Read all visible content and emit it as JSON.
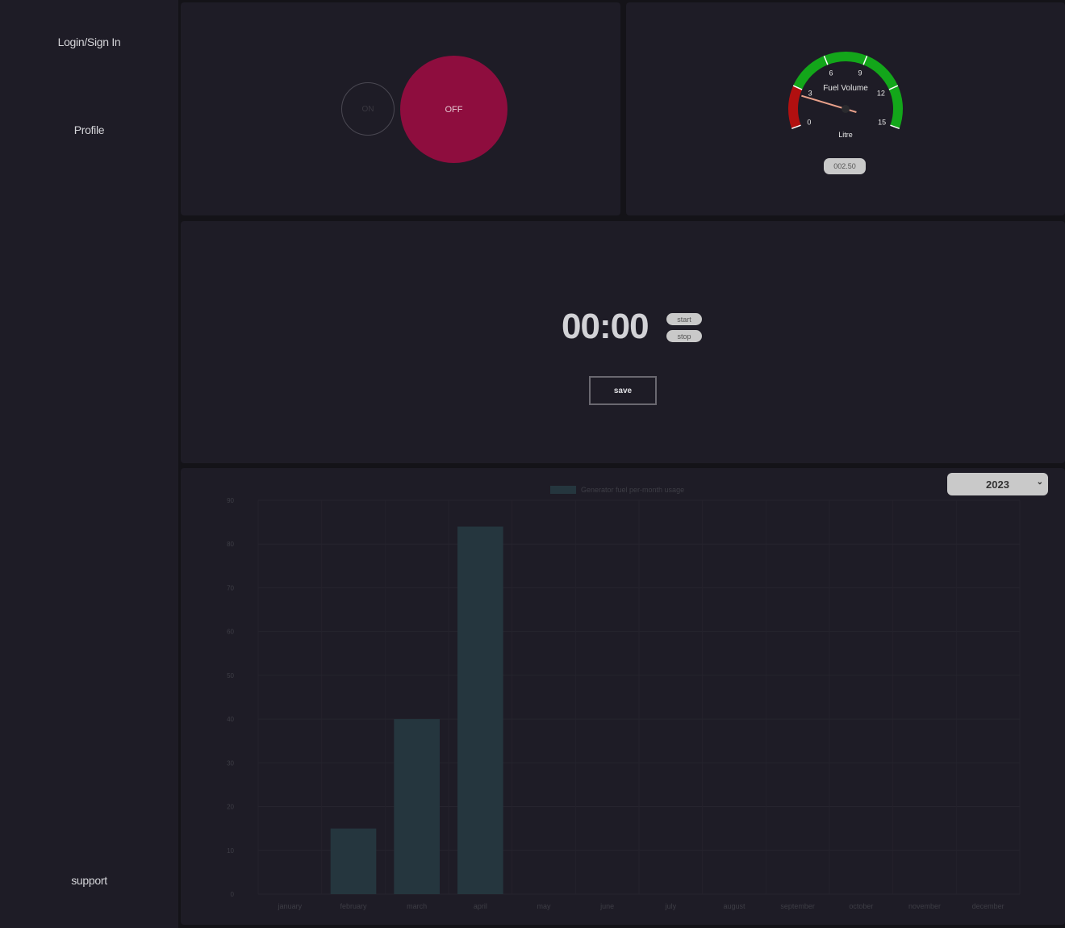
{
  "sidebar": {
    "login_label": "Login/Sign In",
    "profile_label": "Profile",
    "support_label": "support"
  },
  "power": {
    "on_label": "ON",
    "off_label": "OFF",
    "off_color": "#8e0d3e"
  },
  "gauge": {
    "title": "Fuel Volume",
    "unit": "Litre",
    "ticks": [
      "0",
      "3",
      "6",
      "9",
      "12",
      "15"
    ],
    "readout": "002.50",
    "value": 2.5,
    "min": 0,
    "max": 15,
    "danger_color": "#b11010",
    "ok_color": "#13a61a"
  },
  "timer": {
    "display": "00:00",
    "start_label": "start",
    "stop_label": "stop",
    "save_label": "save"
  },
  "year_select": {
    "selected": "2023"
  },
  "chart_data": {
    "type": "bar",
    "legend": "Generator fuel per-month usage",
    "categories": [
      "january",
      "february",
      "march",
      "april",
      "may",
      "june",
      "july",
      "august",
      "september",
      "october",
      "november",
      "december"
    ],
    "values": [
      0,
      15,
      40,
      84,
      0,
      0,
      0,
      0,
      0,
      0,
      0,
      0
    ],
    "y_ticks": [
      "0",
      "10",
      "20",
      "30",
      "40",
      "50",
      "60",
      "70",
      "80",
      "90"
    ],
    "ylim": [
      0,
      90
    ],
    "bar_color": "#25363e",
    "grid": true,
    "legend_position": "top"
  }
}
